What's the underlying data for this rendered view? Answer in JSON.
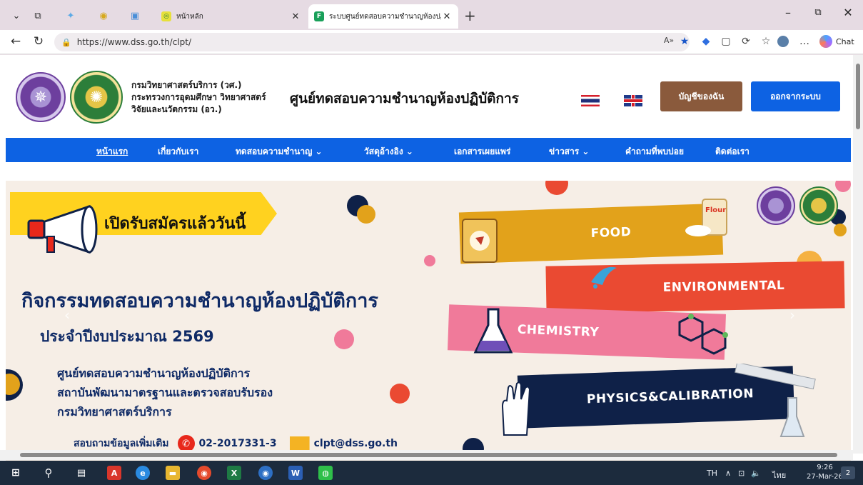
{
  "browser": {
    "tabs": [
      {
        "title": "หน้าหลัก",
        "active": false
      },
      {
        "title": "ระบบศูนย์ทดสอบความชำนาญห้องปฏิบัติ",
        "active": true
      }
    ],
    "url": "https://www.dss.go.th/clpt/",
    "chat_label": "Chat"
  },
  "site": {
    "dept_lines": [
      "กรมวิทยาศาสตร์บริการ (วศ.)",
      "กระทรวงการอุดมศึกษา วิทยาศาสตร์",
      "วิจัยและนวัตกรรม (อว.)"
    ],
    "title": "ศูนย์ทดสอบความชำนาญห้องปฏิบัติการ",
    "account_button": "บัญชีของฉัน",
    "logout_button": "ออกจากระบบ",
    "nav": [
      {
        "label": "หน้าแรก",
        "current": true,
        "dropdown": false
      },
      {
        "label": "เกี่ยวกับเรา",
        "current": false,
        "dropdown": false
      },
      {
        "label": "ทดสอบความชำนาญ",
        "current": false,
        "dropdown": true
      },
      {
        "label": "วัสดุอ้างอิง",
        "current": false,
        "dropdown": true
      },
      {
        "label": "เอกสารเผยแพร่",
        "current": false,
        "dropdown": false
      },
      {
        "label": "ข่าวสาร",
        "current": false,
        "dropdown": true
      },
      {
        "label": "คำถามที่พบบ่อย",
        "current": false,
        "dropdown": false
      },
      {
        "label": "ติดต่อเรา",
        "current": false,
        "dropdown": false
      }
    ]
  },
  "banner": {
    "open_text": "เปิดรับสมัครแล้ววันนี้",
    "heading": "กิจกรรมทดสอบความชำนาญห้องปฏิบัติการ",
    "fiscal_year": "ประจำปีงบประมาณ 2569",
    "org_lines": [
      "ศูนย์ทดสอบความชำนาญห้องปฏิบัติการ",
      "สถาบันพัฒนามาตรฐานและตรวจสอบรับรอง",
      "กรมวิทยาศาสตร์บริการ"
    ],
    "contact_label": "สอบถามข้อมูลเพิ่มเติม",
    "phone": "02-2017331-3",
    "email": "clpt@dss.go.th",
    "flour_label": "Flour",
    "categories": [
      "FOOD",
      "ENVIRONMENTAL",
      "CHEMISTRY",
      "PHYSICS&CALIBRATION"
    ]
  },
  "taskbar": {
    "lang": "TH",
    "ime": "ไทย",
    "time": "9:26",
    "date": "27-Mar-26",
    "notifications": "2"
  }
}
